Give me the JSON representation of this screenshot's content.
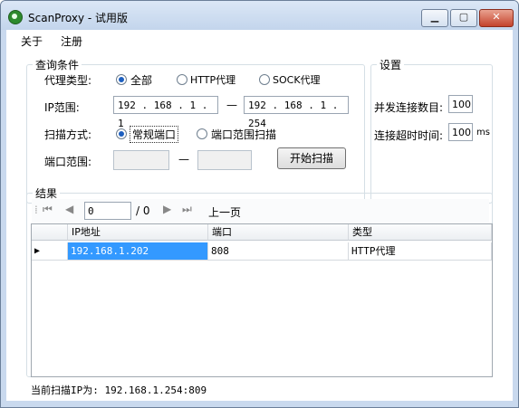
{
  "window": {
    "title": "ScanProxy - 试用版"
  },
  "menu": {
    "items": [
      "关于",
      "注册"
    ]
  },
  "query": {
    "legend": "查询条件",
    "proxy_type_label": "代理类型:",
    "proxy_types": [
      "全部",
      "HTTP代理",
      "SOCK代理"
    ],
    "ip_range_label": "IP范围:",
    "ip_start": "192 . 168 .  1  .  1",
    "ip_end": "192 . 168 .  1  . 254",
    "scan_mode_label": "扫描方式:",
    "scan_modes": [
      "常规端口",
      "端口范围扫描"
    ],
    "port_range_label": "端口范围:",
    "dash": "—",
    "start_button": "开始扫描"
  },
  "settings": {
    "legend": "设置",
    "concurrency_label": "并发连接数目:",
    "concurrency_value": "100",
    "timeout_label": "连接超时时间:",
    "timeout_value": "100",
    "timeout_unit": "ms"
  },
  "results": {
    "legend": "结果",
    "page_value": "0",
    "page_total": "/ 0",
    "prev_label": "上一页",
    "columns": [
      "IP地址",
      "端口",
      "类型"
    ],
    "rows": [
      {
        "ip": "192.168.1.202",
        "port": "808",
        "type": "HTTP代理"
      }
    ]
  },
  "status": {
    "text": "当前扫描IP为: 192.168.1.254:809"
  },
  "colors": {
    "selection": "#3399ff",
    "titlebar": "#c9d9ee",
    "close": "#c4432c"
  }
}
